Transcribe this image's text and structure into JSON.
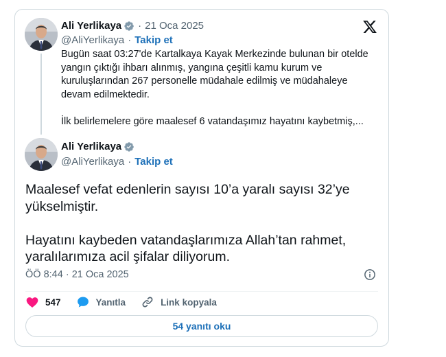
{
  "quoted_tweet": {
    "author_name": "Ali Yerlikaya",
    "date": "21 Oca 2025",
    "handle": "@AliYerlikaya",
    "follow_label": "Takip et",
    "text": "Bugün saat 03:27'de Kartalkaya Kayak Merkezinde bulunan bir otelde yangın çıktığı ihbarı alınmış, yangına çeşitli kamu kurum ve kuruluşlarından 267 personelle müdahale edilmiş ve müdahaleye devam edilmektedir.\n\nİlk belirlemelere göre maalesef 6 vatandaşımız hayatını kaybetmiş,..."
  },
  "main_tweet": {
    "author_name": "Ali Yerlikaya",
    "handle": "@AliYerlikaya",
    "follow_label": "Takip et",
    "text": "Maalesef vefat edenlerin sayısı 10’a yaralı sayısı 32’ye yükselmiştir.\n\nHayatını kaybeden vatandaşlarımıza Allah’tan rahmet, yaralılarımıza acil şifalar diliyorum.",
    "timestamp": "ÖÖ 8:44 · 21 Oca 2025"
  },
  "actions": {
    "like_count": "547",
    "reply_label": "Yanıtla",
    "copy_link_label": "Link kopyala"
  },
  "read_replies_label": "54 yanıtı oku",
  "separator": "·",
  "colors": {
    "accent": "#1d9bf0",
    "link": "#1d70b8",
    "like": "#f91880",
    "muted": "#536471",
    "border": "#cfd9de"
  },
  "icons": [
    "x-logo-icon",
    "verified-badge-icon",
    "info-icon",
    "heart-icon",
    "reply-icon",
    "link-icon"
  ]
}
